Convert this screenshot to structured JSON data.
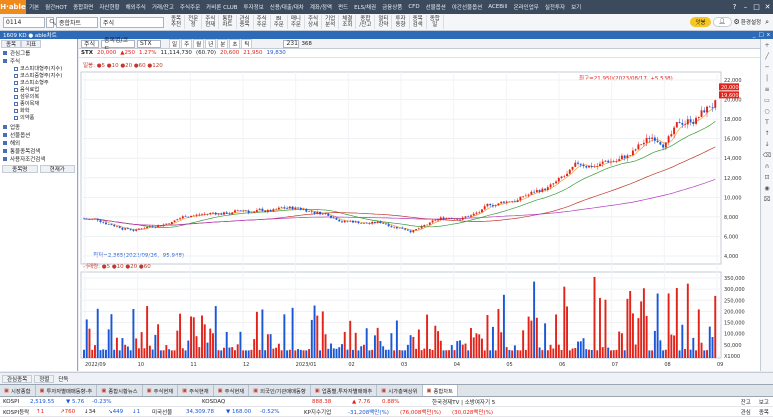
{
  "menubar": {
    "logo": "H·able",
    "items": [
      "기본",
      "월간HOT",
      "종합화면",
      "자산현황",
      "해외주식",
      "거래/잔고",
      "주식주문",
      "카비론 CLUB",
      "투자정보",
      "신용/대출/대차",
      "계좌/정액",
      "펀드",
      "ELS/채권",
      "금융상품",
      "CFD",
      "선물옵션",
      "야간선물옵션",
      "ACEBill",
      "온라인업무",
      "실전투자",
      "보기"
    ],
    "right_icons": [
      "help-icon",
      "minimize-icon",
      "maximize-icon",
      "close-icon"
    ]
  },
  "toolbar": {
    "screen_no": "0114",
    "screen_name": "종합차트",
    "stock_code": "주식",
    "buttons": [
      [
        "종목",
        "추천"
      ],
      [
        "전문",
        "정"
      ],
      [
        "주식",
        "현재"
      ],
      [
        "통합",
        "차트"
      ],
      [
        "관심",
        "종목"
      ],
      [
        "주식",
        "주문"
      ],
      [
        "BI",
        "주문"
      ],
      [
        "매니",
        "주문"
      ],
      [
        "주식",
        "상세"
      ],
      [
        "기업",
        "분석"
      ],
      [
        "체결",
        "조회"
      ],
      [
        "종합",
        "/잔고"
      ],
      [
        "멀티",
        "강약"
      ],
      [
        "투자",
        "동향"
      ],
      [
        "종목",
        "검색"
      ],
      [
        "종합",
        "일"
      ]
    ],
    "ad_pill": "앗봉",
    "settings_label": "환경설정"
  },
  "window_title": "1609 KD ● able차트",
  "left_panel": {
    "tabs": [
      "종목",
      "지표"
    ],
    "group_main": "관심그룹",
    "group_stock": "주식",
    "tree_items": [
      "코스피대형주(지수)",
      "코스피중형주(지수)",
      "코스피소형주",
      "음식료업",
      "섬유의복",
      "종이목재",
      "화학",
      "의약품"
    ],
    "groups": [
      "업종",
      "선물옵션",
      "해외",
      "통물종목검색",
      "사용자조건검색"
    ],
    "bottom_buttons": [
      "종목명",
      "현재가"
    ],
    "footer_buttons": [
      "관심등록",
      "삭제"
    ]
  },
  "chart_toolbar": {
    "code": "주식",
    "category": "종목명/코드",
    "name": "STX",
    "periods": [
      "일",
      "주",
      "월",
      "년",
      "분",
      "초",
      "틱"
    ],
    "count": "231",
    "max": "368"
  },
  "chart_info": {
    "ticker": "STX",
    "price": "20,000",
    "change": "▲250",
    "pct": "1.27%",
    "volume": "11,114,730",
    "ratio": "(60.70)",
    "open": "20,600",
    "high": "21,950",
    "low": "19,830"
  },
  "price_indicator": "일봉: ●5 ●10 ●20 ●60 ●120",
  "hi_label": "최고=21,950(2023/08/17, +5.538)",
  "lo_label": "최저=2,365(2022/09/26, -95.948)",
  "volume_indicator": "거래량: ●5 ●10 ●20 ●60",
  "current_tag": "20,000",
  "prev_tag": "19,600",
  "chart_data": {
    "type": "candlestick",
    "price_axis": [
      "22,000",
      "20,000",
      "18,000",
      "16,000",
      "14,000",
      "12,000",
      "10,000",
      "8,000",
      "6,000",
      "4,000"
    ],
    "volume_axis": [
      "350,000",
      "300,000",
      "250,000",
      "200,000",
      "150,000",
      "100,000",
      "50,000",
      "X1000"
    ],
    "x_labels": [
      "2022/09",
      "10",
      "11",
      "12",
      "2023/01",
      "02",
      "03",
      "04",
      "05",
      "06",
      "07",
      "08",
      "09"
    ]
  },
  "status_left": {
    "buttons": [
      "관심종목",
      "정렬"
    ],
    "chk": "단독"
  },
  "bottom_tabs": [
    "시장종합",
    "투자자별매매동향-추",
    "종합시황뉴스",
    "주식현재",
    "주식현재",
    "주식현재",
    "외국인/기관매매동향",
    "업종별,투자자별매매추",
    "시가총액상위",
    "종합차트"
  ],
  "ticker_rows": [
    {
      "name": "KOSPI",
      "value": "2,519.55",
      "chg": "▼ 5.76",
      "pct": "-0.23%",
      "name2": "KOSDAQ",
      "value2": "888.38",
      "chg2": "▲ 7.76",
      "pct2": "0.88%",
      "news": "한국경제TV | 소방여자기 5",
      "a": "",
      "b": "",
      "label": "잔고",
      "label2": "보고"
    },
    {
      "name": "KOSPI등락",
      "value": "↑1",
      "v2": "↗760",
      "v3": "↓34",
      "v4": "↘449",
      "v5": "↓1",
      "name2": "미국선물",
      "value2": "34,309.78",
      "chg2": "▼ 168.00",
      "pct2": "-0.52%",
      "news": "KP지수기업",
      "val": "-31,208백만(%)",
      "val2": "(76,008백만(%)",
      "val3": "(30,028백만(%)",
      "label": "관심",
      "label2": "종목"
    }
  ]
}
